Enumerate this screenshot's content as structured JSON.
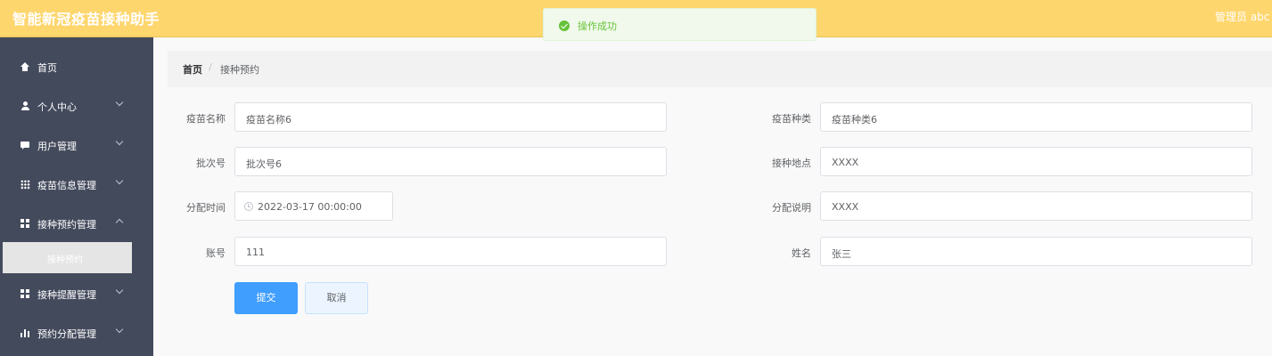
{
  "header": {
    "title": "智能新冠疫苗接种助手",
    "user": "管理员 abc"
  },
  "toast": {
    "message": "操作成功"
  },
  "sidebar": {
    "items": [
      {
        "label": "首页",
        "icon": "home-icon"
      },
      {
        "label": "个人中心",
        "icon": "user-icon"
      },
      {
        "label": "用户管理",
        "icon": "chat-icon"
      },
      {
        "label": "疫苗信息管理",
        "icon": "grid-icon"
      },
      {
        "label": "接种预约管理",
        "icon": "apps-icon"
      },
      {
        "label": "接种提醒管理",
        "icon": "apps-icon"
      },
      {
        "label": "预约分配管理",
        "icon": "bar-chart-icon"
      }
    ],
    "active_sub": "接种预约"
  },
  "breadcrumb": {
    "home": "首页",
    "separator": "/",
    "current": "接种预约"
  },
  "form": {
    "vaccine_name": {
      "label": "疫苗名称",
      "value": "疫苗名称6"
    },
    "vaccine_type": {
      "label": "疫苗种类",
      "value": "疫苗种类6"
    },
    "batch_no": {
      "label": "批次号",
      "value": "批次号6"
    },
    "location": {
      "label": "接种地点",
      "value": "XXXX"
    },
    "assign_time": {
      "label": "分配时间",
      "value": "2022-03-17 00:00:00"
    },
    "assign_note": {
      "label": "分配说明",
      "value": "XXXX"
    },
    "account": {
      "label": "账号",
      "value": "111"
    },
    "name": {
      "label": "姓名",
      "value": "张三"
    },
    "submit_label": "提交",
    "cancel_label": "取消"
  },
  "colors": {
    "header_bg": "#fed66e",
    "sidebar_bg": "#434a5c",
    "primary": "#409eff",
    "success": "#67c23a"
  }
}
